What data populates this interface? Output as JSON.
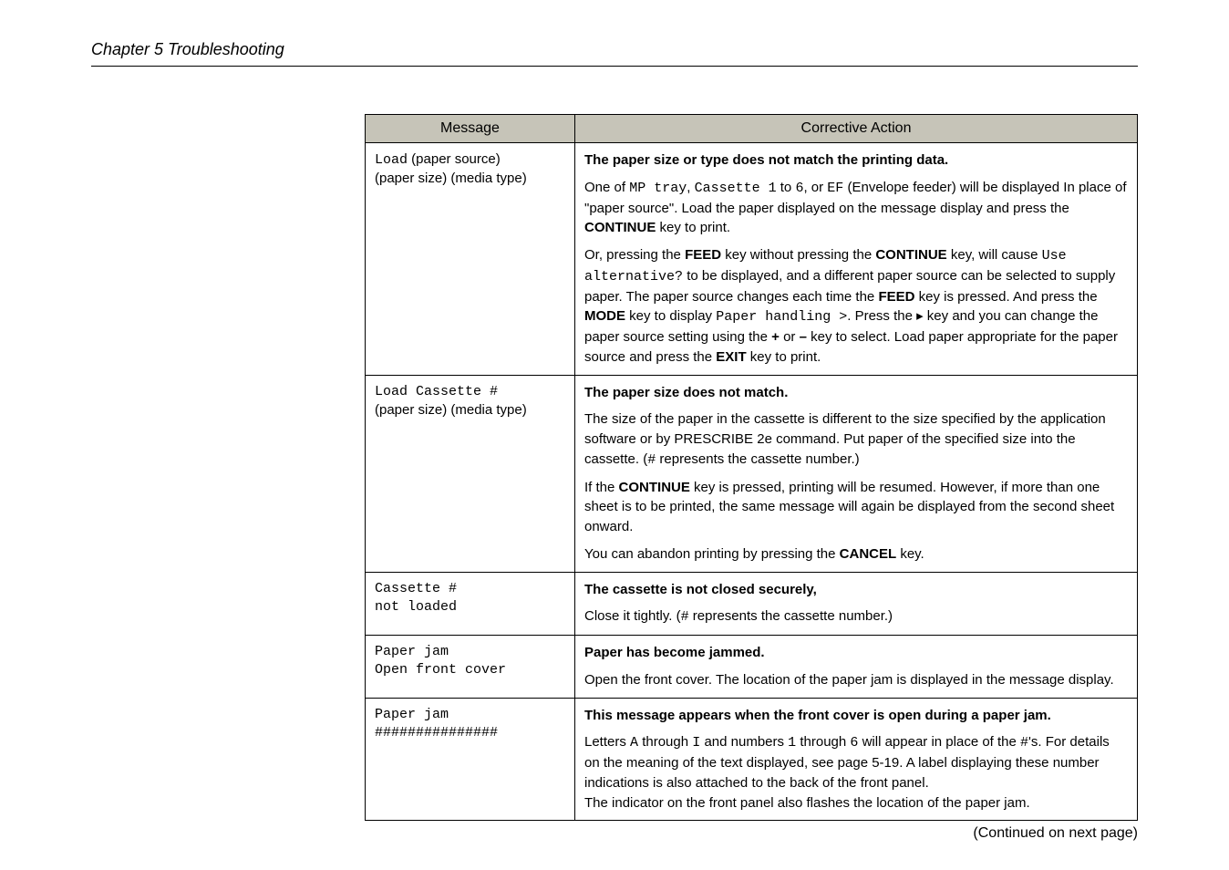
{
  "chapter": "Chapter 5  Troubleshooting",
  "headers": {
    "msg": "Message",
    "action": "Corrective Action"
  },
  "continued": "(Continued on next page)",
  "rows": {
    "r1": {
      "msg_code": "Load",
      "msg_plain1": " (paper source)",
      "msg_plain2": "(paper size) (media type)",
      "a_title": "The paper size or type does not match the printing data.",
      "a_p1_1": "One of ",
      "a_p1_c1": "MP tray",
      "a_p1_2": ", ",
      "a_p1_c2": "Cassette 1",
      "a_p1_3": " to ",
      "a_p1_c3": "6",
      "a_p1_4": ", or ",
      "a_p1_c4": "EF",
      "a_p1_5": " (Envelope feeder) will be displayed In place of \"paper source\". Load the paper displayed on the message display and press the ",
      "a_p1_b1": "CONTINUE",
      "a_p1_6": " key to print.",
      "a_p2_1": "Or, pressing the ",
      "a_p2_b1": "FEED",
      "a_p2_2": " key without pressing the ",
      "a_p2_b2": "CONTINUE",
      "a_p2_3": " key, will cause ",
      "a_p2_c1": "Use alternative?",
      "a_p2_4": " to be displayed, and a different paper source can be selected to supply paper. The paper source changes each time the ",
      "a_p2_b3": "FEED",
      "a_p2_5": " key is pressed. And press the ",
      "a_p2_b4": "MODE",
      "a_p2_6": " key to display ",
      "a_p2_c2": "Paper handling >",
      "a_p2_7": ". Press the ▸ key and you can change the paper source setting using the ",
      "a_p2_b5": "+",
      "a_p2_8": " or ",
      "a_p2_b6": "–",
      "a_p2_9": " key to select. Load paper appropriate for the paper source and press the ",
      "a_p2_b7": "EXIT",
      "a_p2_10": " key to print."
    },
    "r2": {
      "msg_code": "Load Cassette #",
      "msg_plain": "(paper size) (media type)",
      "a_title": "The paper size does not match.",
      "a_p1_1": "The size of the paper in the cassette is different to the size specified by the application software or by PRESCRIBE 2e command. Put paper of the specified size into the cassette. (",
      "a_p1_c1": "#",
      "a_p1_2": " represents the cassette number.)",
      "a_p2_1": "If the ",
      "a_p2_b1": "CONTINUE",
      "a_p2_2": " key is pressed, printing will be resumed. However, if more than one sheet is to be printed, the same message will again be displayed from the second sheet onward.",
      "a_p3_1": "You can abandon printing by pressing the ",
      "a_p3_b1": "CANCEL",
      "a_p3_2": " key."
    },
    "r3": {
      "msg_l1": "Cassette #",
      "msg_l2": "not loaded",
      "a_title": "The cassette is not closed securely,",
      "a_p1_1": "Close it tightly. (",
      "a_p1_c1": "#",
      "a_p1_2": " represents the cassette number.)"
    },
    "r4": {
      "msg_l1": "Paper jam",
      "msg_l2": "Open front cover",
      "a_title": "Paper has become jammed.",
      "a_p1": "Open the front cover.  The location of the paper jam is displayed in the message display."
    },
    "r5": {
      "msg_l1": "Paper jam",
      "msg_l2": "###############",
      "a_title": "This message appears when the front cover is open during a paper jam.",
      "a_p1_1": "Letters ",
      "a_p1_c1": "A",
      "a_p1_2": " through ",
      "a_p1_c2": "I",
      "a_p1_3": " and numbers ",
      "a_p1_c3": "1",
      "a_p1_4": " through ",
      "a_p1_c4": "6",
      "a_p1_5": " will appear in place of the ",
      "a_p1_c5": "#",
      "a_p1_6": "'s. For details on the meaning of the text displayed, see page 5-19.  A label displaying these number indications is also attached to the back of the front panel.",
      "a_p2": "The indicator on the front panel also flashes the location of the paper jam."
    }
  }
}
